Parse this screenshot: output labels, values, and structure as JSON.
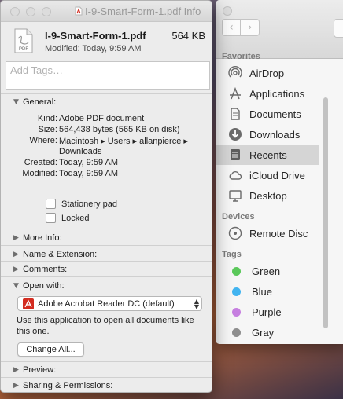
{
  "finder": {
    "nav_back": "‹",
    "nav_forward": "›",
    "sections": {
      "favorites": "Favorites",
      "devices": "Devices",
      "tags": "Tags"
    },
    "favorites": [
      {
        "label": "AirDrop",
        "icon": "airdrop-icon"
      },
      {
        "label": "Applications",
        "icon": "applications-icon"
      },
      {
        "label": "Documents",
        "icon": "documents-icon"
      },
      {
        "label": "Downloads",
        "icon": "downloads-icon"
      },
      {
        "label": "Recents",
        "icon": "recents-icon",
        "selected": true
      },
      {
        "label": "iCloud Drive",
        "icon": "icloud-icon"
      },
      {
        "label": "Desktop",
        "icon": "desktop-icon"
      }
    ],
    "devices": [
      {
        "label": "Remote Disc",
        "icon": "disc-icon"
      }
    ],
    "tags": [
      {
        "label": "Green",
        "color": "#5ac85a"
      },
      {
        "label": "Blue",
        "color": "#42b4f0"
      },
      {
        "label": "Purple",
        "color": "#c67fe0"
      },
      {
        "label": "Gray",
        "color": "#8e8e8e"
      }
    ]
  },
  "info": {
    "window_title": "I-9-Smart-Form-1.pdf Info",
    "file_name": "I-9-Smart-Form-1.pdf",
    "file_size": "564 KB",
    "modified": "Modified: Today, 9:59 AM",
    "tags_placeholder": "Add Tags…",
    "general": {
      "label": "General:",
      "kind_k": "Kind:",
      "kind_v": "Adobe PDF document",
      "size_k": "Size:",
      "size_v": "564,438 bytes (565 KB on disk)",
      "where_k": "Where:",
      "where_v1": "Macintosh ▸ Users ▸ allanpierce ▸",
      "where_v2": "Downloads",
      "created_k": "Created:",
      "created_v": "Today, 9:59 AM",
      "modified_k": "Modified:",
      "modified_v": "Today, 9:59 AM",
      "stationery": "Stationery pad",
      "locked": "Locked"
    },
    "more_info": "More Info:",
    "name_ext": "Name & Extension:",
    "comments": "Comments:",
    "open_with": {
      "label": "Open with:",
      "app": "Adobe Acrobat Reader DC (default)",
      "description": "Use this application to open all documents like this one.",
      "change_all": "Change All..."
    },
    "preview": "Preview:",
    "sharing": "Sharing & Permissions:"
  },
  "colors": {
    "selection": "#d5d5d5",
    "acrobat_red": "#d32c20"
  }
}
